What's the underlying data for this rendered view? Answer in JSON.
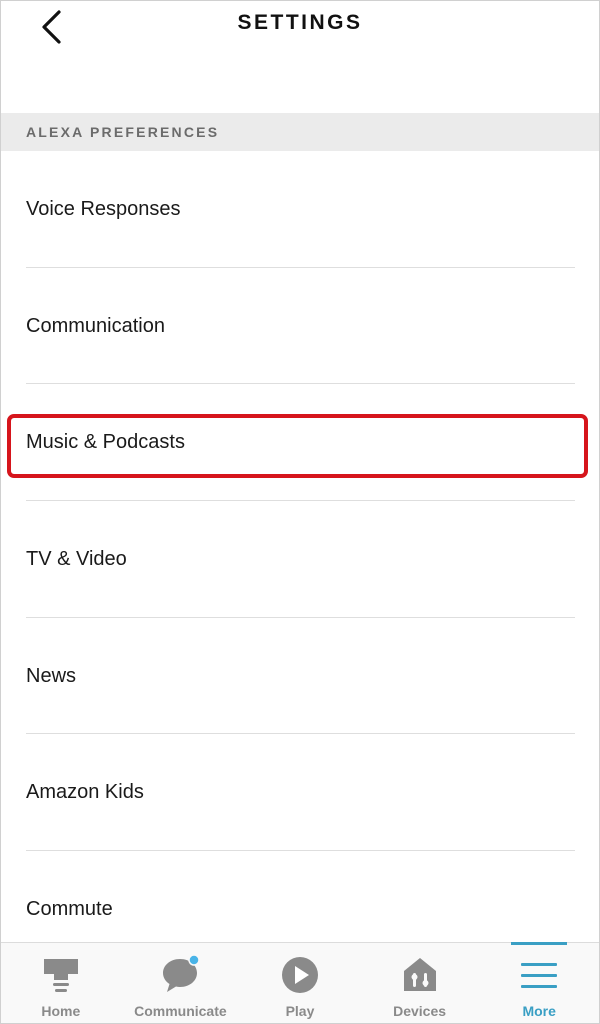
{
  "header": {
    "title": "SETTINGS",
    "back_icon": "chevron-left-icon"
  },
  "section": {
    "title": "ALEXA PREFERENCES"
  },
  "items": [
    {
      "label": "Voice Responses"
    },
    {
      "label": "Communication"
    },
    {
      "label": "Music & Podcasts",
      "highlighted": true
    },
    {
      "label": "TV & Video"
    },
    {
      "label": "News"
    },
    {
      "label": "Amazon Kids"
    },
    {
      "label": "Commute"
    }
  ],
  "tabs": [
    {
      "label": "Home",
      "icon": "home-icon",
      "active": false
    },
    {
      "label": "Communicate",
      "icon": "chat-bubble-icon",
      "active": false,
      "notification_dot": true
    },
    {
      "label": "Play",
      "icon": "play-icon",
      "active": false
    },
    {
      "label": "Devices",
      "icon": "devices-icon",
      "active": false
    },
    {
      "label": "More",
      "icon": "menu-icon",
      "active": true
    }
  ],
  "colors": {
    "accent": "#3a9fc4",
    "highlight": "#d6151c",
    "section_bg": "#ebebeb",
    "icon_gray": "#8a8a8a",
    "notification_dot": "#49b4e8"
  }
}
